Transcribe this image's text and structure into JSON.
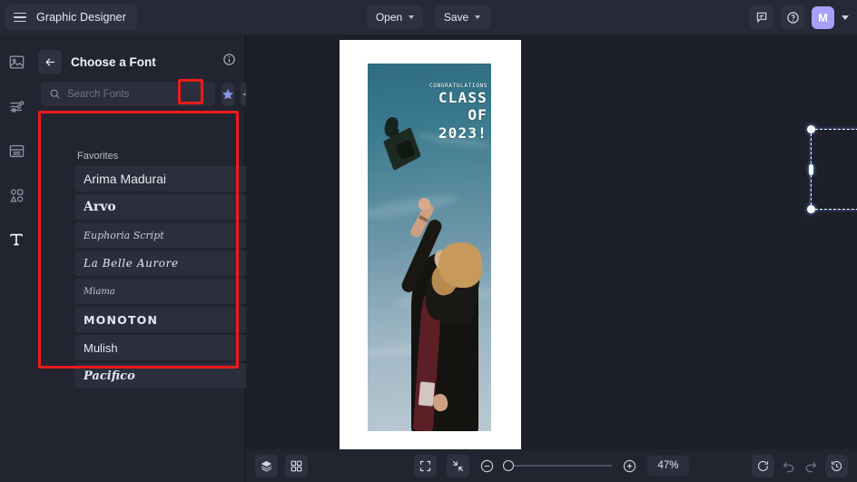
{
  "app": {
    "title": "Graphic Designer",
    "accent_purple": "#a6a0f7",
    "annotation_red": "#ee1b1b",
    "panel_bg": "#22242f",
    "topbar_bg": "#262936"
  },
  "topbar": {
    "menu_icon": "hamburger-icon",
    "open_label": "Open",
    "save_label": "Save",
    "comment_icon": "comment-icon",
    "help_icon": "help-circle-icon",
    "avatar_initial": "M",
    "account_chevron": "chevron-down-icon"
  },
  "left_rail": {
    "items": [
      {
        "name": "images",
        "icon": "image-icon",
        "active": false
      },
      {
        "name": "adjustments",
        "icon": "sliders-icon",
        "active": false
      },
      {
        "name": "layouts",
        "icon": "layout-icon",
        "active": false
      },
      {
        "name": "shapes",
        "icon": "shapes-icon",
        "active": false
      },
      {
        "name": "text",
        "icon": "text-t-icon",
        "active": true
      }
    ]
  },
  "font_panel": {
    "back_icon": "arrow-left-icon",
    "title": "Choose a Font",
    "info_icon": "info-circle-icon",
    "search": {
      "placeholder": "Search Fonts",
      "value": "",
      "icon": "search-icon"
    },
    "favorites_button": {
      "icon": "star-icon",
      "label": "Favorites",
      "active": true
    },
    "add_button": {
      "icon": "plus-icon",
      "label": "Add font"
    },
    "list_label": "Favorites",
    "fonts": [
      {
        "name": "Arima Madurai",
        "has_chevron": true,
        "style": "f-arima"
      },
      {
        "name": "Arvo",
        "has_chevron": false,
        "style": "f-arvo"
      },
      {
        "name": "Euphoria Script",
        "has_chevron": false,
        "style": "f-euph"
      },
      {
        "name": "La Belle Aurore",
        "has_chevron": false,
        "style": "f-belle"
      },
      {
        "name": "Miama",
        "has_chevron": false,
        "style": "f-miama"
      },
      {
        "name": "Monoton",
        "has_chevron": false,
        "style": "f-mono"
      },
      {
        "name": "Mulish",
        "has_chevron": true,
        "style": "f-mulish"
      },
      {
        "name": "Pacifico",
        "has_chevron": false,
        "style": "f-pacifico"
      }
    ],
    "chevron_glyph": "›"
  },
  "canvas": {
    "artwork": {
      "line1": "CONGRATULATIONS",
      "line2": "CLASS OF",
      "line3": "2023!",
      "description": "graduation-photo-sky-cap-toss"
    },
    "selection": {
      "visible": true,
      "handles": 8,
      "rotation_handle": true
    }
  },
  "bottombar": {
    "layers_icon": "layers-icon",
    "grid_icon": "grid-icon",
    "fit_icon": "fit-to-screen-icon",
    "collapse_icon": "shrink-arrows-icon",
    "zoom_out_icon": "minus-circle-icon",
    "zoom_in_icon": "plus-circle-icon",
    "zoom_value": "47%",
    "refresh_icon": "refresh-icon",
    "undo_icon": "undo-icon",
    "redo_icon": "redo-icon",
    "history_icon": "history-clock-icon"
  }
}
